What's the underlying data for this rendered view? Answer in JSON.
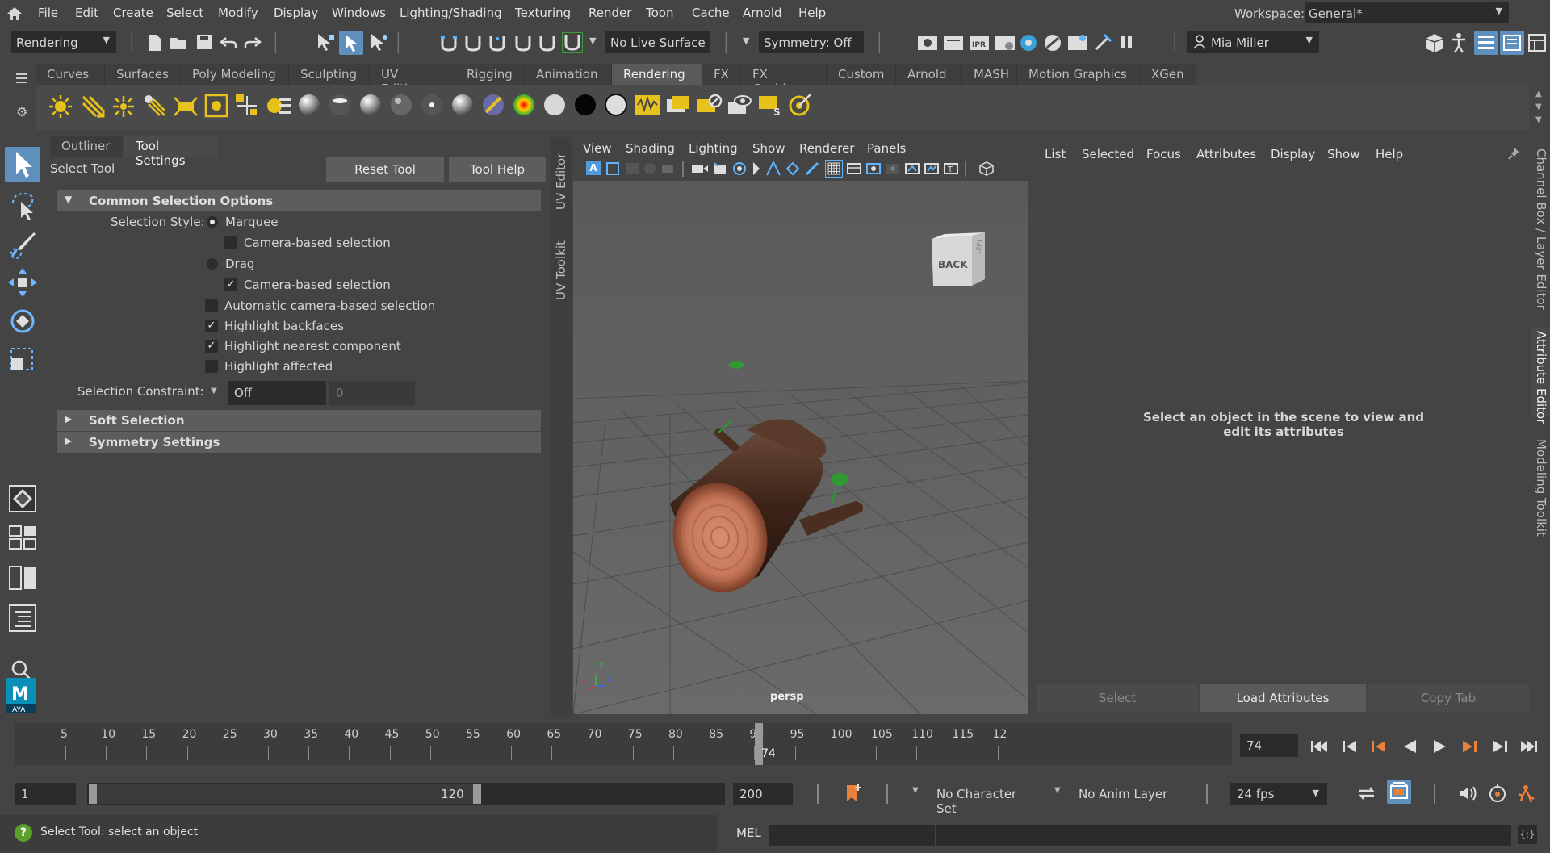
{
  "menubar": {
    "items": [
      "File",
      "Edit",
      "Create",
      "Select",
      "Modify",
      "Display",
      "Windows",
      "Lighting/Shading",
      "Texturing",
      "Render",
      "Toon",
      "Cache",
      "Arnold",
      "Help"
    ],
    "workspace_label": "Workspace:",
    "workspace_value": "General*"
  },
  "statusline": {
    "menuset": "Rendering",
    "live_surface": "No Live Surface",
    "symmetry": "Symmetry: Off",
    "user": "Mia Miller"
  },
  "shelf": {
    "tabs": [
      "Curves",
      "Surfaces",
      "Poly Modeling",
      "Sculpting",
      "UV Editing",
      "Rigging",
      "Animation",
      "Rendering",
      "FX",
      "FX Caching",
      "Custom",
      "Arnold",
      "MASH",
      "Motion Graphics",
      "XGen"
    ],
    "active_tab": "Rendering"
  },
  "tool_settings": {
    "tabs": [
      "Outliner",
      "Tool Settings"
    ],
    "tool_name": "Select Tool",
    "reset_button": "Reset Tool",
    "help_button": "Tool Help",
    "sections": {
      "common": "Common Selection Options",
      "soft": "Soft Selection",
      "symmetry": "Symmetry Settings"
    },
    "selection_style_label": "Selection Style:",
    "marquee": "Marquee",
    "camera_based_1": "Camera-based selection",
    "drag": "Drag",
    "camera_based_2": "Camera-based selection",
    "auto_camera": "Automatic camera-based selection",
    "highlight_backfaces": "Highlight backfaces",
    "highlight_nearest": "Highlight nearest component",
    "highlight_affected": "Highlight affected",
    "constraint_label": "Selection Constraint:",
    "constraint_value": "Off",
    "constraint_num": "0",
    "states": {
      "style": "Marquee",
      "camera_based_1": false,
      "camera_based_2": true,
      "auto_camera": false,
      "highlight_backfaces": true,
      "highlight_nearest": true,
      "highlight_affected": false
    }
  },
  "side_tabs": {
    "uv_editor": "UV Editor",
    "uv_toolkit": "UV Toolkit",
    "channel_box": "Channel Box / Layer Editor",
    "attribute_editor": "Attribute Editor",
    "modeling_toolkit": "Modeling Toolkit"
  },
  "viewport": {
    "menu": [
      "View",
      "Shading",
      "Lighting",
      "Show",
      "Renderer",
      "Panels"
    ],
    "camera": "persp",
    "viewcube_face": "BACK",
    "viewcube_side": "LEFT",
    "axis_labels": [
      "x",
      "y",
      "z"
    ]
  },
  "attribute_editor": {
    "menu": [
      "List",
      "Selected",
      "Focus",
      "Attributes",
      "Display",
      "Show",
      "Help"
    ],
    "message": "Select an object in the scene to view and edit its attributes",
    "buttons": [
      "Select",
      "Load Attributes",
      "Copy Tab"
    ]
  },
  "timeline": {
    "ticks": [
      "5",
      "10",
      "15",
      "20",
      "25",
      "30",
      "35",
      "40",
      "45",
      "50",
      "55",
      "60",
      "65",
      "70",
      "75",
      "80",
      "85",
      "90",
      "95",
      "100",
      "105",
      "110",
      "115",
      "12"
    ],
    "current_frame": "74",
    "current_frame_field": "74"
  },
  "range": {
    "start": "1",
    "inner_start": "1",
    "inner_end": "120",
    "end": "200",
    "character_set": "No Character Set",
    "anim_layer": "No Anim Layer",
    "fps": "24 fps"
  },
  "commandline": {
    "help_text": "Select Tool: select an object",
    "lang": "MEL"
  },
  "colors": {
    "active_blue": "#5e8fbd",
    "shelf_yellow": "#e6c21a",
    "playhead_orange": "#e8823a"
  }
}
